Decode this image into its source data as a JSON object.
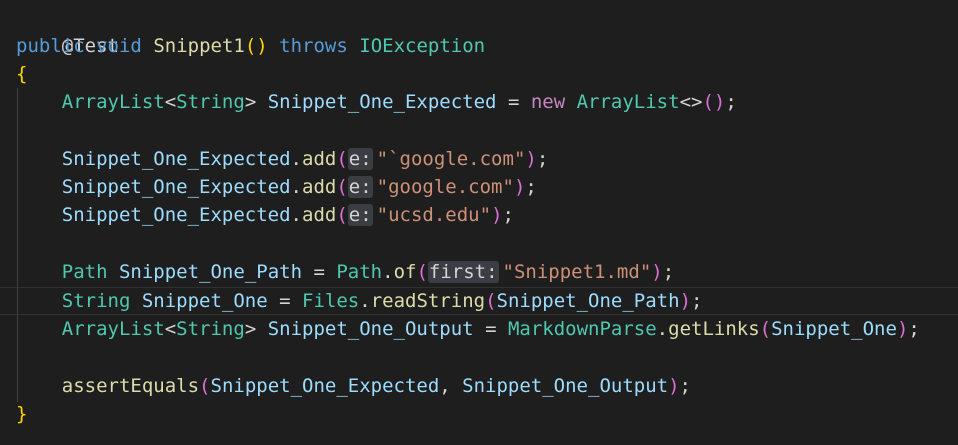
{
  "code": {
    "l1": {
      "annotation": "@Test"
    },
    "l2": {
      "kw_public": "public",
      "kw_void": "void",
      "method": "Snippet1",
      "parens": "()",
      "kw_throws": "throws",
      "exception": "IOException"
    },
    "l3": {
      "brace": "{"
    },
    "l4": {
      "type": "ArrayList",
      "lt": "<",
      "generic": "String",
      "gt": ">",
      "var": "Snippet_One_Expected",
      "eq": " = ",
      "kw_new": "new",
      "ctor": "ArrayList",
      "diamond": "<>",
      "parens": "()",
      "semi": ";"
    },
    "l6": {
      "var": "Snippet_One_Expected",
      "dot": ".",
      "method": "add",
      "open": "(",
      "hint": "e:",
      "arg": "\"`google.com\"",
      "close": ")",
      "semi": ";"
    },
    "l7": {
      "var": "Snippet_One_Expected",
      "dot": ".",
      "method": "add",
      "open": "(",
      "hint": "e:",
      "arg": "\"google.com\"",
      "close": ")",
      "semi": ";"
    },
    "l8": {
      "var": "Snippet_One_Expected",
      "dot": ".",
      "method": "add",
      "open": "(",
      "hint": "e:",
      "arg": "\"ucsd.edu\"",
      "close": ")",
      "semi": ";"
    },
    "l10": {
      "type": "Path",
      "var": "Snippet_One_Path",
      "eq": " = ",
      "cls": "Path",
      "dot": ".",
      "method": "of",
      "open": "(",
      "hint": "first:",
      "arg": "\"Snippet1.md\"",
      "close": ")",
      "semi": ";"
    },
    "l11": {
      "type": "String",
      "var": "Snippet_One",
      "eq": " = ",
      "cls": "Files",
      "dot": ".",
      "method": "readString",
      "open": "(",
      "arg": "Snippet_One_Path",
      "close": ")",
      "semi": ";"
    },
    "l12": {
      "type": "ArrayList",
      "lt": "<",
      "generic": "String",
      "gt": ">",
      "var": "Snippet_One_Output",
      "eq": " = ",
      "cls": "MarkdownParse",
      "dot": ".",
      "method": "getLinks",
      "open": "(",
      "arg": "Snippet_One",
      "close": ")",
      "semi": ";"
    },
    "l14": {
      "method": "assertEquals",
      "open": "(",
      "arg1": "Snippet_One_Expected",
      "comma": ", ",
      "arg2": "Snippet_One_Output",
      "close": ")",
      "semi": ";"
    },
    "l15": {
      "brace": "}"
    }
  },
  "colors": {
    "background": "#1e1e1e",
    "keyword": "#569cd6",
    "control_keyword": "#c586c0",
    "type": "#4ec9b0",
    "function": "#dcdcaa",
    "variable": "#9cdcfe",
    "string": "#ce9178",
    "bracket_level1": "#ffd700",
    "bracket_level2": "#da70d6",
    "bracket_level3": "#179fff",
    "inlay_hint_bg": "#3a3d41"
  }
}
